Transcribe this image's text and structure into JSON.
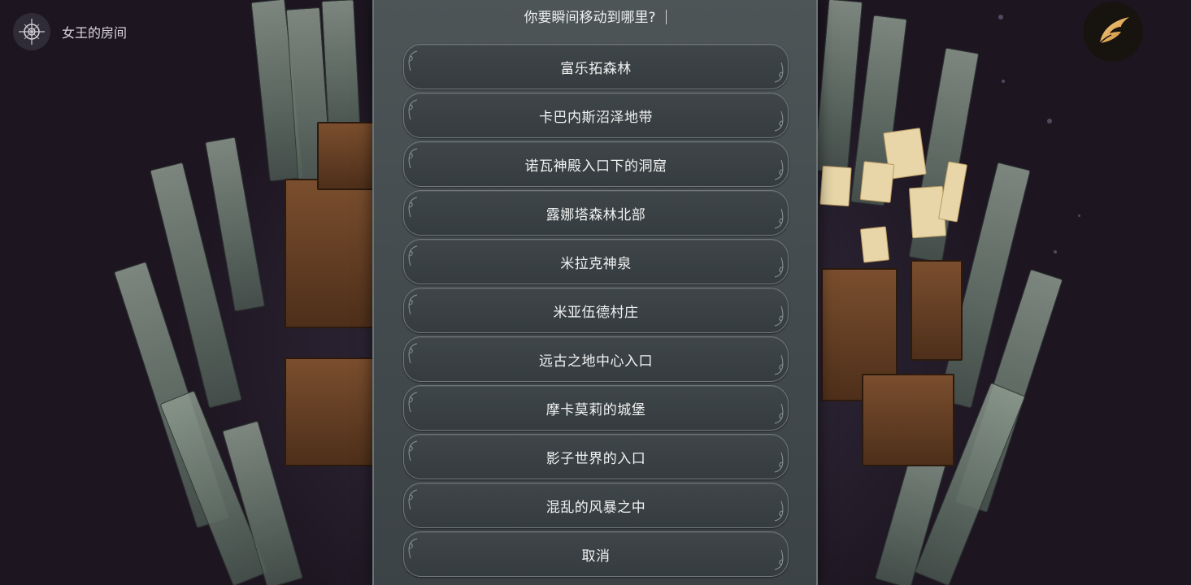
{
  "location": {
    "name": "女王的房间",
    "icon": "compass-icon"
  },
  "menu": {
    "icon": "wing-icon",
    "accent": "#e0a64a"
  },
  "dialog": {
    "prompt": "你要瞬间移动到哪里?",
    "options": [
      {
        "label": "富乐拓森林"
      },
      {
        "label": "卡巴内斯沼泽地带"
      },
      {
        "label": "诺瓦神殿入口下的洞窟"
      },
      {
        "label": "露娜塔森林北部"
      },
      {
        "label": "米拉克神泉"
      },
      {
        "label": "米亚伍德村庄"
      },
      {
        "label": "远古之地中心入口"
      },
      {
        "label": "摩卡莫莉的城堡"
      },
      {
        "label": "影子世界的入口"
      },
      {
        "label": "混乱的风暴之中"
      },
      {
        "label": "取消"
      }
    ]
  }
}
